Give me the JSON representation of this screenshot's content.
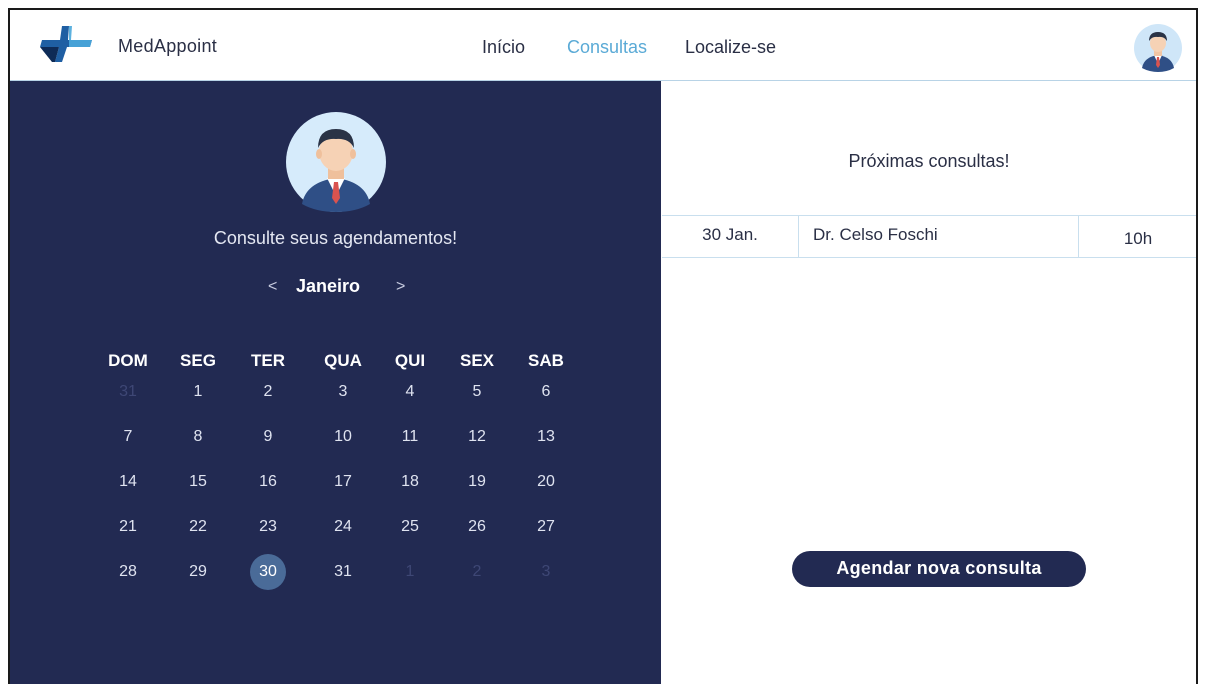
{
  "header": {
    "app_name": "MedAppoint",
    "nav": [
      {
        "label": "Início",
        "active": false
      },
      {
        "label": "Consultas",
        "active": true
      },
      {
        "label": "Localize-se",
        "active": false
      }
    ]
  },
  "left": {
    "subtitle": "Consulte seus agendamentos!",
    "calendar": {
      "month": "Janeiro",
      "prev_icon": "<",
      "next_icon": ">",
      "weekdays": [
        "DOM",
        "SEG",
        "TER",
        "QUA",
        "QUI",
        "SEX",
        "SAB"
      ],
      "weeks": [
        [
          "31",
          "1",
          "2",
          "3",
          "4",
          "5",
          "6"
        ],
        [
          "7",
          "8",
          "9",
          "10",
          "11",
          "12",
          "13"
        ],
        [
          "14",
          "15",
          "16",
          "17",
          "18",
          "19",
          "20"
        ],
        [
          "21",
          "22",
          "23",
          "24",
          "25",
          "26",
          "27"
        ],
        [
          "28",
          "29",
          "30",
          "31",
          "1",
          "2",
          "3"
        ]
      ],
      "selected_day": "30"
    }
  },
  "right": {
    "title": "Próximas consultas!",
    "appointments": [
      {
        "date": "30 Jan.",
        "doctor": "Dr. Celso Foschi",
        "time": "10h"
      }
    ],
    "cta_label": "Agendar nova consulta"
  },
  "colors": {
    "primary_navy": "#222a52",
    "accent_blue": "#5aaad6",
    "selected_day": "#4a6b98"
  },
  "icons": {
    "logo": "medappoint-cross-logo-icon",
    "user_avatar": "user-avatar-icon"
  }
}
